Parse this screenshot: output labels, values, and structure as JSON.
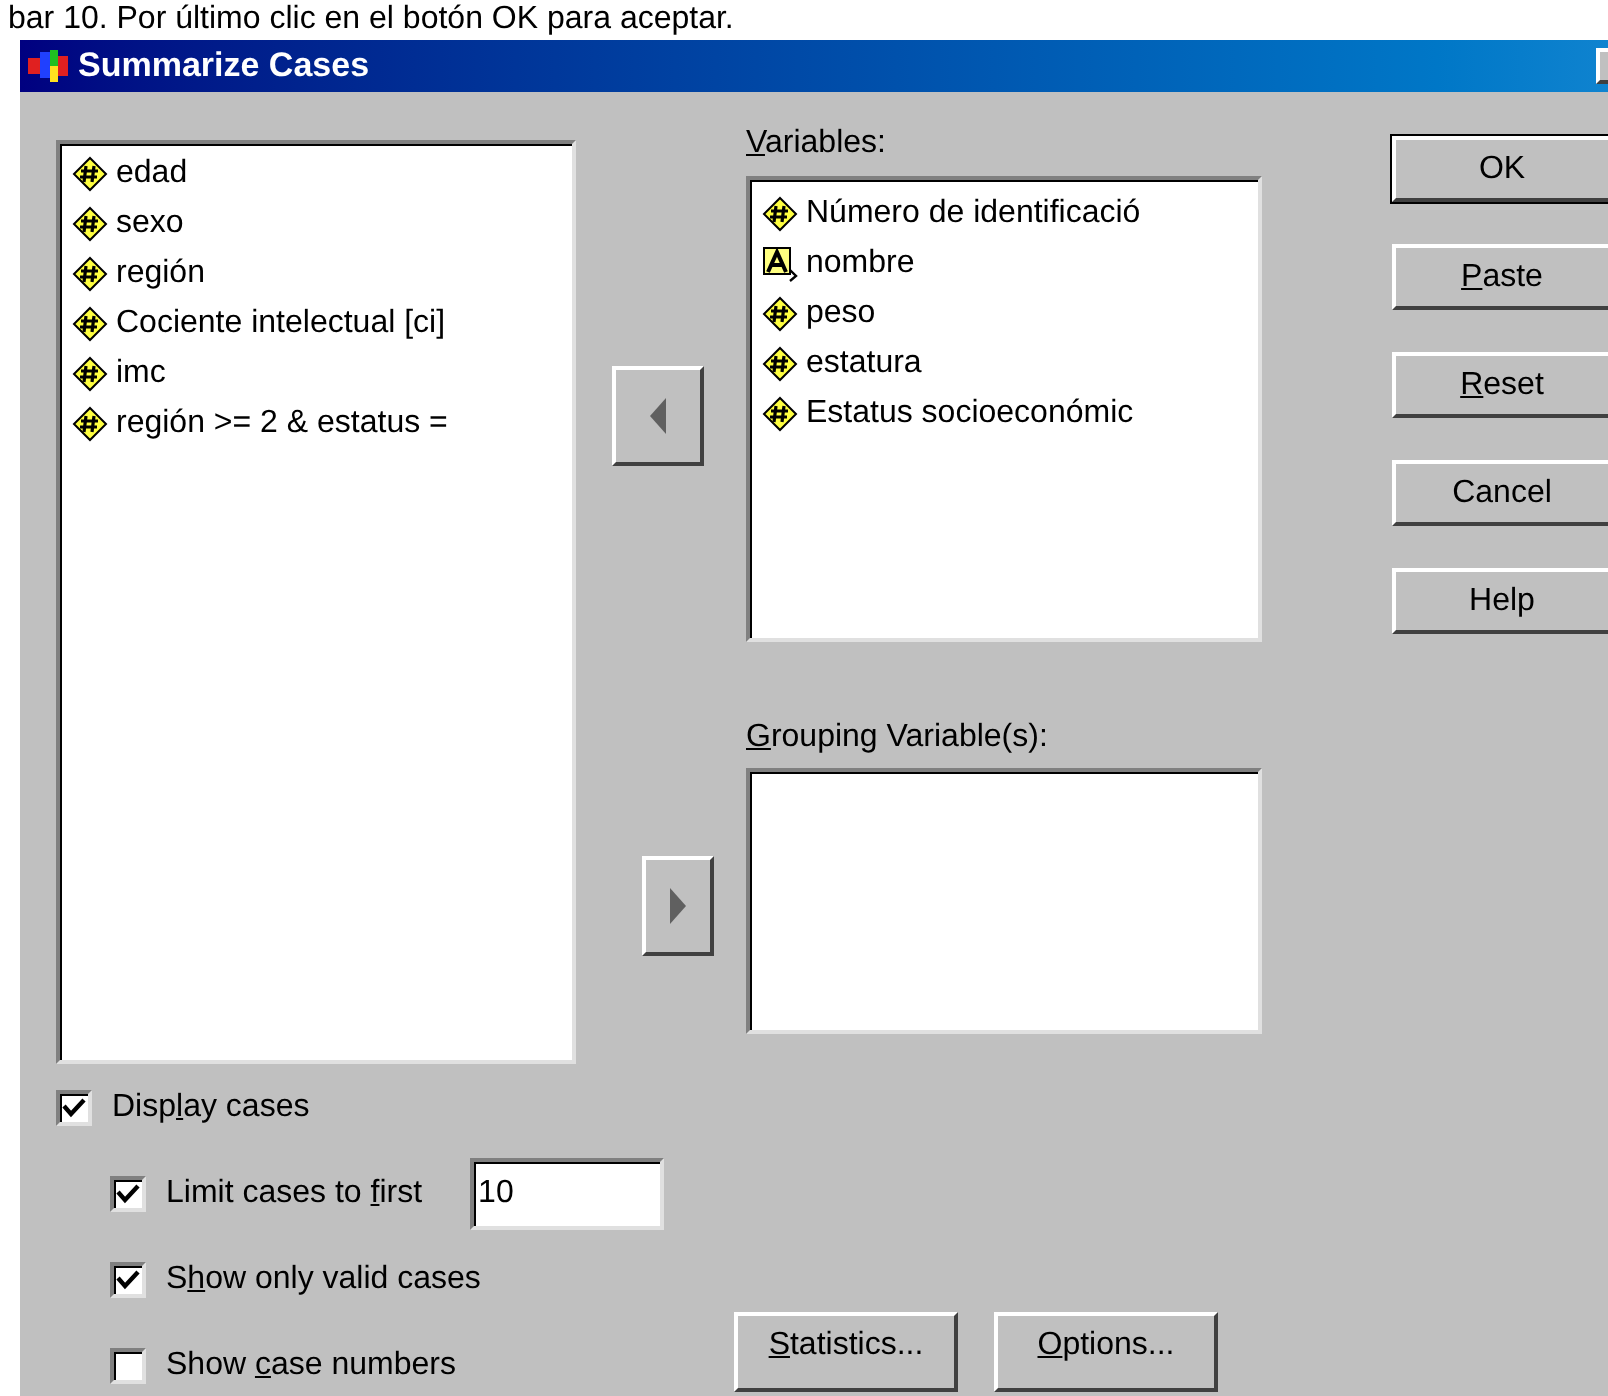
{
  "caption": "bar 10. Por último clic en el botón OK para aceptar.",
  "window": {
    "title": "Summarize Cases"
  },
  "source_list": [
    {
      "kind": "scale",
      "label": "edad"
    },
    {
      "kind": "scale",
      "label": "sexo"
    },
    {
      "kind": "scale",
      "label": "región"
    },
    {
      "kind": "scale",
      "label": "Cociente intelectual [ci]"
    },
    {
      "kind": "scale",
      "label": "imc"
    },
    {
      "kind": "scale",
      "label": "región >= 2 & estatus ="
    }
  ],
  "variables": {
    "label": [
      {
        "text": "V",
        "underlined": true
      },
      {
        "text": "ariables:",
        "underlined": false
      }
    ],
    "items": [
      {
        "kind": "scale",
        "label": "Número de identificació"
      },
      {
        "kind": "string",
        "label": "nombre"
      },
      {
        "kind": "scale",
        "label": "peso"
      },
      {
        "kind": "scale",
        "label": "estatura"
      },
      {
        "kind": "scale",
        "label": "Estatus socioeconómic"
      }
    ]
  },
  "grouping": {
    "label": [
      {
        "text": "G",
        "underlined": true
      },
      {
        "text": "rouping Variable(s):",
        "underlined": false
      }
    ]
  },
  "buttons": [
    {
      "label": [
        {
          "text": "OK",
          "underlined": false
        }
      ],
      "default": true
    },
    {
      "label": [
        {
          "text": "P",
          "underlined": true
        },
        {
          "text": "aste",
          "underlined": false
        }
      ],
      "default": false
    },
    {
      "label": [
        {
          "text": "R",
          "underlined": true
        },
        {
          "text": "eset",
          "underlined": false
        }
      ],
      "default": false
    },
    {
      "label": [
        {
          "text": "Cancel",
          "underlined": false
        }
      ],
      "default": false
    },
    {
      "label": [
        {
          "text": "Help",
          "underlined": false
        }
      ],
      "default": false
    }
  ],
  "options": [
    {
      "label": [
        {
          "text": "Disp",
          "underlined": false
        },
        {
          "text": "l",
          "underlined": true
        },
        {
          "text": "ay cases",
          "underlined": false
        }
      ],
      "checked": true,
      "indented": false
    },
    {
      "label": [
        {
          "text": "Limit cases to ",
          "underlined": false
        },
        {
          "text": "f",
          "underlined": true
        },
        {
          "text": "irst",
          "underlined": false
        }
      ],
      "checked": true,
      "indented": true,
      "value": "10"
    },
    {
      "label": [
        {
          "text": "S",
          "underlined": false
        },
        {
          "text": "h",
          "underlined": true
        },
        {
          "text": "ow only valid cases",
          "underlined": false
        }
      ],
      "checked": true,
      "indented": true
    },
    {
      "label": [
        {
          "text": "Show ",
          "underlined": false
        },
        {
          "text": "c",
          "underlined": true
        },
        {
          "text": "ase numbers",
          "underlined": false
        }
      ],
      "checked": false,
      "indented": true
    }
  ],
  "bottom_buttons": [
    {
      "label": [
        {
          "text": "S",
          "underlined": true
        },
        {
          "text": "tatistics...",
          "underlined": false
        }
      ]
    },
    {
      "label": [
        {
          "text": "O",
          "underlined": true
        },
        {
          "text": "ptions...",
          "underlined": false
        }
      ]
    }
  ]
}
